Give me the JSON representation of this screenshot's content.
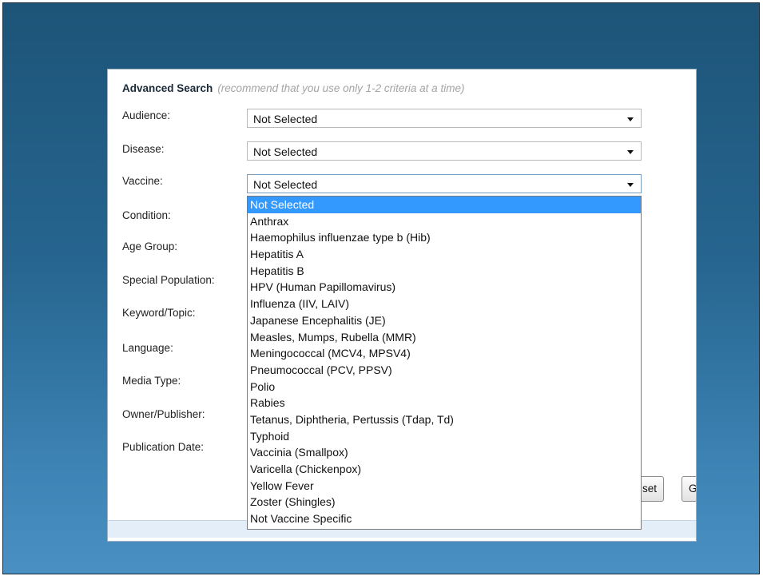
{
  "form": {
    "title": "Advanced Search",
    "hint": "(recommend that you use only 1-2 criteria at a time)",
    "fields": [
      {
        "label": "Audience:",
        "value": "Not Selected"
      },
      {
        "label": "Disease:",
        "value": "Not Selected"
      },
      {
        "label": "Vaccine:",
        "value": "Not Selected"
      },
      {
        "label": "Condition:"
      },
      {
        "label": "Age Group:"
      },
      {
        "label": "Special Population:"
      },
      {
        "label": "Keyword/Topic:"
      },
      {
        "label": "Language:"
      },
      {
        "label": "Media Type:"
      },
      {
        "label": "Owner/Publisher:"
      },
      {
        "label": "Publication Date:"
      }
    ]
  },
  "vaccine_dropdown": {
    "selected_index": 0,
    "options": [
      "Not Selected",
      "Anthrax",
      "Haemophilus influenzae type b (Hib)",
      "Hepatitis A",
      "Hepatitis B",
      "HPV (Human Papillomavirus)",
      "Influenza (IIV, LAIV)",
      "Japanese Encephalitis (JE)",
      "Measles, Mumps, Rubella (MMR)",
      "Meningococcal (MCV4, MPSV4)",
      "Pneumococcal (PCV, PPSV)",
      "Polio",
      "Rabies",
      "Tetanus, Diphtheria, Pertussis (Tdap, Td)",
      "Typhoid",
      "Vaccinia (Smallpox)",
      "Varicella (Chickenpox)",
      "Yellow Fever",
      "Zoster (Shingles)",
      "Not Vaccine Specific"
    ]
  },
  "buttons": {
    "reset_label": "set",
    "go_label": "G"
  },
  "colors": {
    "background_top": "#1d5478",
    "background_bottom": "#4a90c2",
    "selected_option": "#3399ff"
  }
}
